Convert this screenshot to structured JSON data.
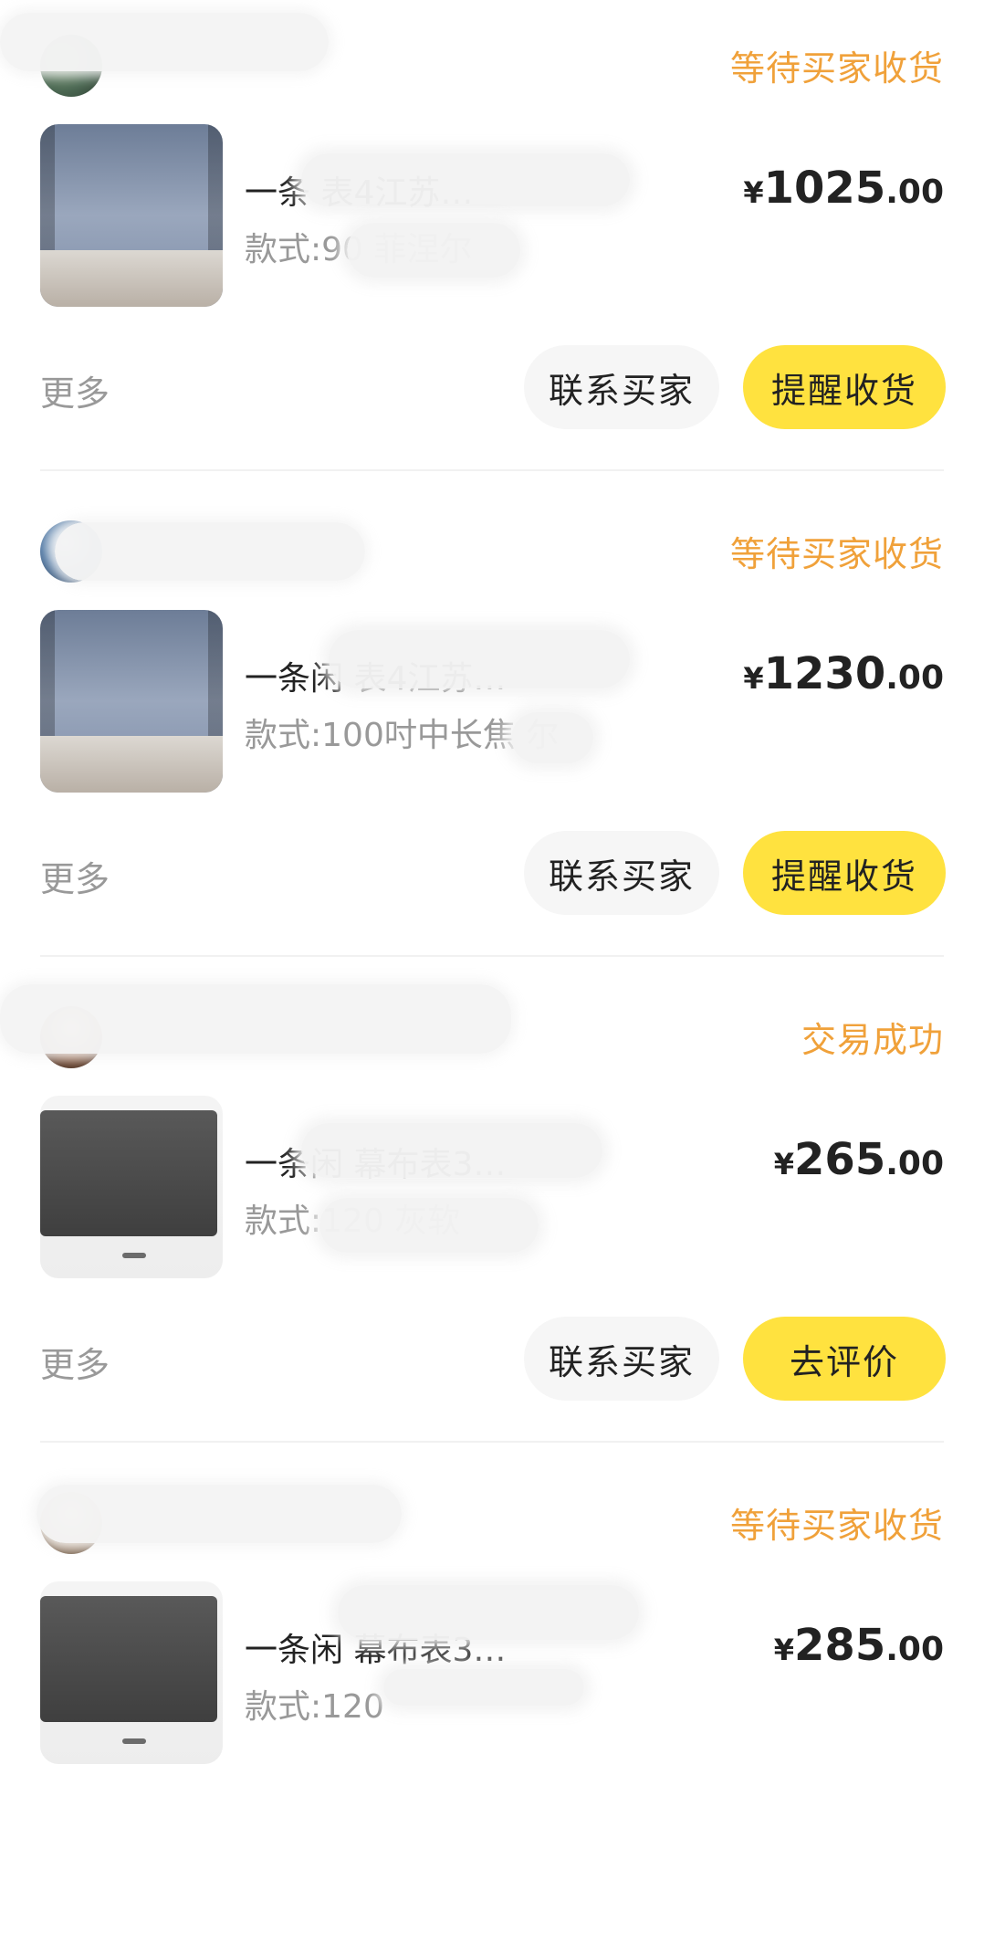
{
  "orders": [
    {
      "status": "等待买家收货",
      "title": "一条 表4江苏…",
      "variant": "款式:90 菲涅尔",
      "price": {
        "symbol": "¥",
        "integer": "1025",
        "decimal": ".00"
      },
      "more_label": "更多",
      "contact_label": "联系买家",
      "primary_label": "提醒收货"
    },
    {
      "status": "等待买家收货",
      "title": "一条闲 表4江苏…",
      "variant": "款式:100吋中长焦 尔",
      "price": {
        "symbol": "¥",
        "integer": "1230",
        "decimal": ".00"
      },
      "more_label": "更多",
      "contact_label": "联系买家",
      "primary_label": "提醒收货"
    },
    {
      "status": "交易成功",
      "title": "一条闲 幕布表3…",
      "variant": "款式:120 灰软",
      "price": {
        "symbol": "¥",
        "integer": "265",
        "decimal": ".00"
      },
      "more_label": "更多",
      "contact_label": "联系买家",
      "primary_label": "去评价"
    },
    {
      "status": "等待买家收货",
      "title": "一条闲 幕布表3…",
      "variant": "款式:120",
      "price": {
        "symbol": "¥",
        "integer": "285",
        "decimal": ".00"
      },
      "more_label": "更多",
      "contact_label": "联系买家",
      "primary_label": "提醒收货"
    }
  ],
  "colors": {
    "status": "#f0a13a",
    "primary_button": "#ffe23f",
    "secondary_button": "#f6f6f6",
    "muted_text": "#999999"
  },
  "icons": {
    "avatar": "user-avatar",
    "product_image": "product-thumbnail"
  }
}
